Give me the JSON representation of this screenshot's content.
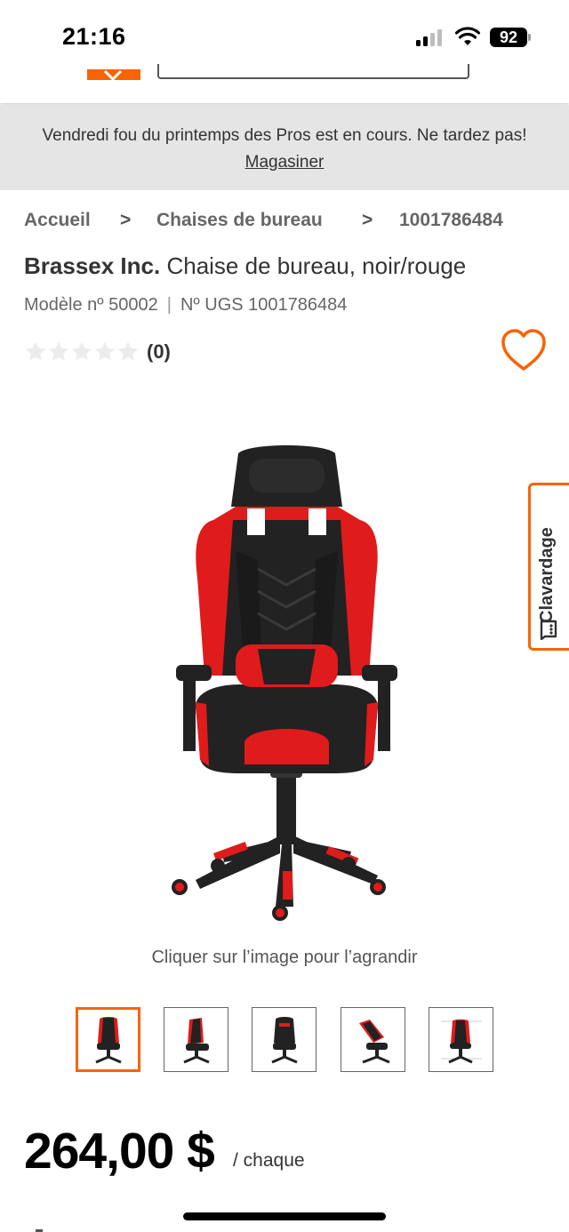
{
  "status_bar": {
    "time": "21:16",
    "battery": "92"
  },
  "promo": {
    "text": "Vendredi fou du printemps des Pros est en cours. Ne tardez pas!",
    "link": "Magasiner"
  },
  "breadcrumb": {
    "items": [
      "Accueil",
      "Chaises de bureau",
      "1001786484"
    ],
    "separator": ">"
  },
  "product": {
    "brand": "Brassex Inc.",
    "name": "Chaise de bureau, noir/rouge",
    "model": "Modèle nº 50002",
    "meta_separator": "|",
    "sku": "Nº UGS 1001786484",
    "rating_count": "(0)",
    "image_caption": "Cliquer sur l’image pour l’agrandir",
    "thumbnail_count": 5,
    "price": "264,00 $",
    "price_unit": "/ chaque"
  },
  "chat": {
    "label": "Clavardage"
  },
  "colors": {
    "brand_orange": "#f96302",
    "banner_bg": "#e5e5e5",
    "chair_red": "#e01b1b",
    "chair_black": "#222222"
  },
  "icons": [
    "signal-icon",
    "wifi-icon",
    "battery-icon",
    "star-icon",
    "heart-icon",
    "chat-icon"
  ]
}
